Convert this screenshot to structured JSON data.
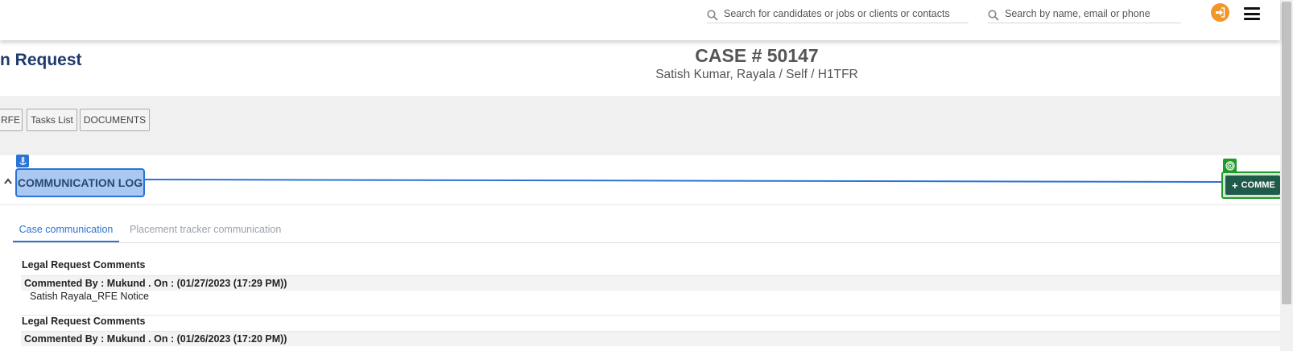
{
  "header": {
    "search_main_placeholder": "Search for candidates or jobs or clients or contacts",
    "search_people_placeholder": "Search by name, email or phone",
    "login_icon": "sign-in-icon",
    "menu_icon": "hamburger-menu-icon",
    "accent_color": "#f0962a"
  },
  "page": {
    "title": "n Request",
    "case_number": "CASE # 50147",
    "case_subtitle": "Satish Kumar, Rayala / Self / H1TFR"
  },
  "nav_buttons": [
    {
      "label": "RFE"
    },
    {
      "label": "Tasks List"
    },
    {
      "label": "DOCUMENTS"
    }
  ],
  "comm_log": {
    "title": "COMMUNICATION LOG",
    "comment_button_label": "COMME",
    "anchor_icon": "anchor-icon",
    "target_icon": "target-icon",
    "title_highlight_color": "#2b73d6",
    "button_highlight_color": "#1e9a2a"
  },
  "tabs": [
    {
      "label": "Case communication",
      "active": true
    },
    {
      "label": "Placement tracker communication",
      "active": false
    }
  ],
  "comments": [
    {
      "section": "Legal Request Comments",
      "meta": "Commented By : Mukund . On : (01/27/2023 (17:29 PM))",
      "body": "Satish Rayala_RFE Notice"
    },
    {
      "section": "Legal Request Comments",
      "meta": "Commented By : Mukund . On : (01/26/2023 (17:20 PM))",
      "body": ""
    }
  ]
}
